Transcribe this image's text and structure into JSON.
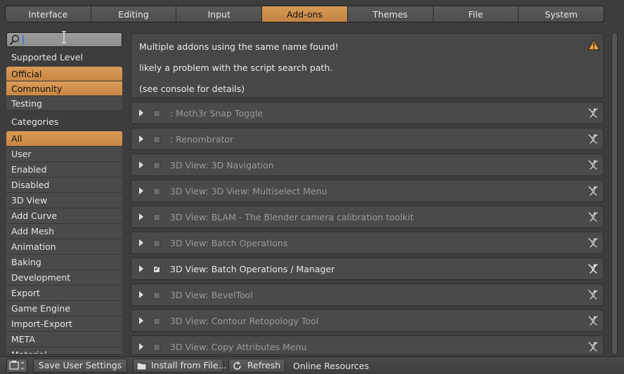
{
  "tabs": [
    {
      "label": "Interface",
      "active": false
    },
    {
      "label": "Editing",
      "active": false
    },
    {
      "label": "Input",
      "active": false
    },
    {
      "label": "Add-ons",
      "active": true
    },
    {
      "label": "Themes",
      "active": false
    },
    {
      "label": "File",
      "active": false
    },
    {
      "label": "System",
      "active": false
    }
  ],
  "search": {
    "value": ""
  },
  "sidebar": {
    "supported_heading": "Supported Level",
    "supported": [
      {
        "label": "Official",
        "on": true
      },
      {
        "label": "Community",
        "on": true
      },
      {
        "label": "Testing",
        "on": false
      }
    ],
    "categories_heading": "Categories",
    "categories": [
      {
        "label": "All",
        "on": true
      },
      {
        "label": "User",
        "on": false
      },
      {
        "label": "Enabled",
        "on": false
      },
      {
        "label": "Disabled",
        "on": false
      },
      {
        "label": "3D View",
        "on": false
      },
      {
        "label": "Add Curve",
        "on": false
      },
      {
        "label": "Add Mesh",
        "on": false
      },
      {
        "label": "Animation",
        "on": false
      },
      {
        "label": "Baking",
        "on": false
      },
      {
        "label": "Development",
        "on": false
      },
      {
        "label": "Export",
        "on": false
      },
      {
        "label": "Game Engine",
        "on": false
      },
      {
        "label": "Import-Export",
        "on": false
      },
      {
        "label": "META",
        "on": false
      },
      {
        "label": "Material",
        "on": false
      }
    ]
  },
  "warning": {
    "line1": "Multiple addons using the same name found!",
    "line2": "likely a problem with the script search path.",
    "line3": "(see console for details)",
    "icon": "warning-triangle-icon"
  },
  "addons": [
    {
      "name": ": Moth3r Snap Toggle",
      "enabled": false
    },
    {
      "name": ": Renombrator",
      "enabled": false
    },
    {
      "name": "3D View: 3D Navigation",
      "enabled": false
    },
    {
      "name": "3D View: 3D View: Multiselect Menu",
      "enabled": false
    },
    {
      "name": "3D View: BLAM - The Blender camera calibration toolkit",
      "enabled": false
    },
    {
      "name": "3D View: Batch Operations",
      "enabled": false
    },
    {
      "name": "3D View: Batch Operations / Manager",
      "enabled": true
    },
    {
      "name": "3D View: BevelTool",
      "enabled": false
    },
    {
      "name": "3D View: Contour Retopology Tool",
      "enabled": false
    },
    {
      "name": "3D View: Copy Attributes Menu",
      "enabled": false
    }
  ],
  "bottom": {
    "save_label": "Save User Settings",
    "install_label": "Install from File...",
    "refresh_label": "Refresh",
    "online_label": "Online Resources"
  },
  "colors": {
    "accent": "#d08f4c",
    "panel": "#4a4a4a",
    "background": "#3d3d3d"
  }
}
